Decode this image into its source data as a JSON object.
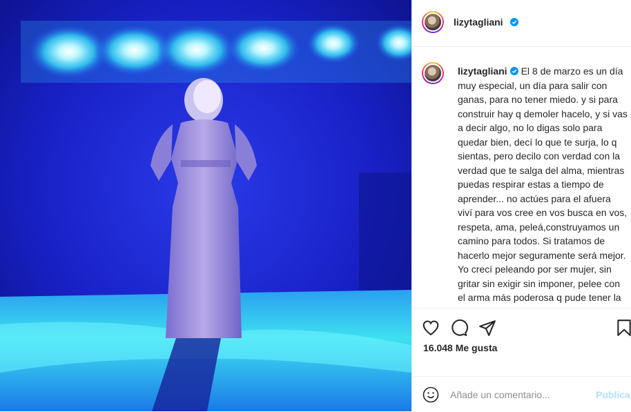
{
  "post": {
    "username": "lizytagliani",
    "caption": "El 8 de marzo es un día muy especial, un día para salir con ganas, para no tener miedo. y si para construir hay q demoler hacelo, y si vas a decir algo, no lo digas solo para quedar bien, decí lo que te surja, lo q sientas, pero decilo con verdad con la verdad que te salga del alma, mientras puedas respirar estas a tiempo de aprender... no actúes para el afuera viví para vos cree en vos busca en vos, respeta, ama, peleá,construyamos un camino para todos. Si tratamos de hacerlo mejor seguramente será mejor. Yo crecí peleando por ser mujer, sin gritar sin exigir sin imponer, pelee con el arma más poderosa q pude tener la fe de creer en mi, tambien hubo quienes dieron su vida, a muchas se las arrebataron, otras",
    "likes": "16.048 Me gusta"
  },
  "comment": {
    "placeholder": "Añade un comentario...",
    "publish_label": "Publicar"
  },
  "colors": {
    "verified": "#0095f6",
    "text": "#262626",
    "muted": "#8e8e8e",
    "publish_disabled": "#b2dffc",
    "photo_blue": "#1a22c8",
    "stage_cyan": "#3ee0f0"
  },
  "icons": [
    "heart-icon",
    "comment-icon",
    "share-icon",
    "bookmark-icon",
    "emoji-icon",
    "verified-icon"
  ]
}
